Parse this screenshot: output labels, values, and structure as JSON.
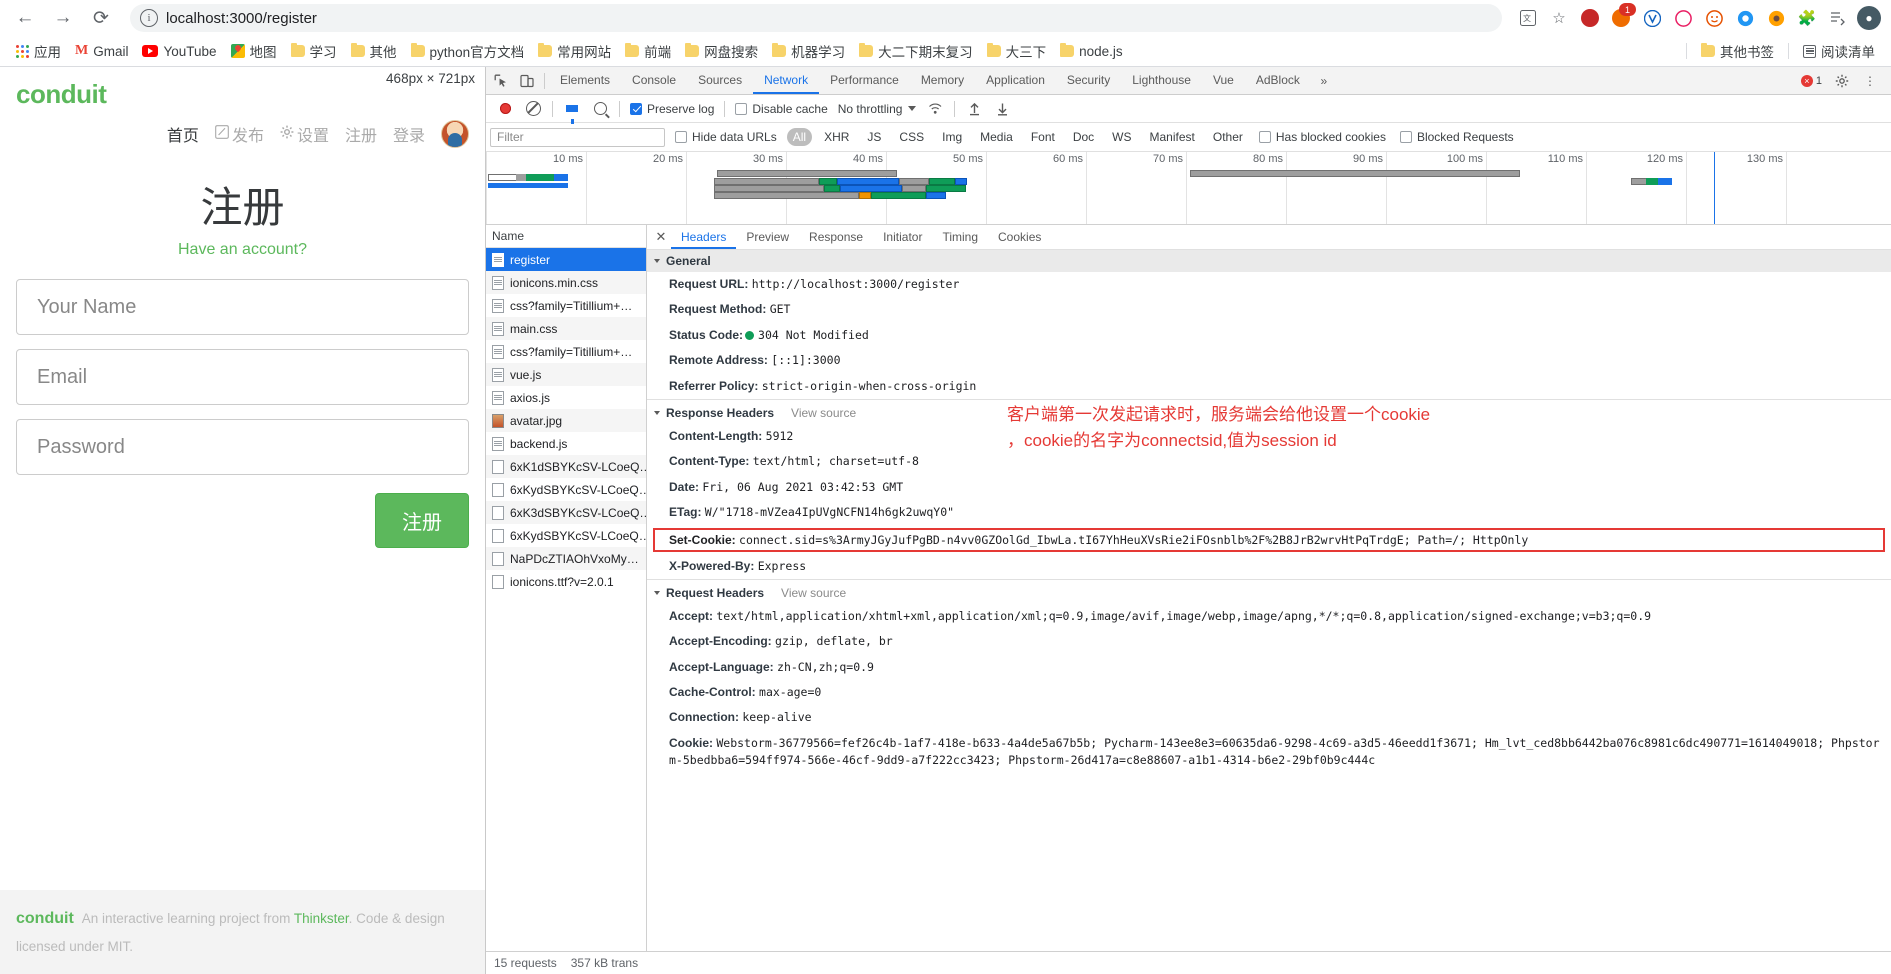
{
  "browser": {
    "back_icon": "back-arrow-icon",
    "forward_icon": "forward-arrow-icon",
    "reload_icon": "reload-icon",
    "url": "localhost:3000/register",
    "url_host": "localhost:3000",
    "url_path": "/register",
    "toolbar_icons": [
      "translate-icon",
      "bookmark-star-icon",
      "extension-shield-icon",
      "extension-badge-icon",
      "extension-v-icon",
      "extension-circle-icon",
      "extension-smiley-icon",
      "extension-blue-icon",
      "extension-orange-icon",
      "puzzle-extensions-icon",
      "menu-list-icon",
      "profile-avatar-icon"
    ],
    "notification_badge": "1",
    "bookmarks": [
      {
        "label": "应用",
        "icon": "apps-grid-icon"
      },
      {
        "label": "Gmail",
        "icon": "gmail-icon"
      },
      {
        "label": "YouTube",
        "icon": "youtube-icon"
      },
      {
        "label": "地图",
        "icon": "maps-icon"
      },
      {
        "label": "学习",
        "icon": "folder-icon"
      },
      {
        "label": "其他",
        "icon": "folder-icon"
      },
      {
        "label": "python官方文档",
        "icon": "folder-icon"
      },
      {
        "label": "常用网站",
        "icon": "folder-icon"
      },
      {
        "label": "前端",
        "icon": "folder-icon"
      },
      {
        "label": "网盘搜索",
        "icon": "folder-icon"
      },
      {
        "label": "机器学习",
        "icon": "folder-icon"
      },
      {
        "label": "大二下期末复习",
        "icon": "folder-icon"
      },
      {
        "label": "大三下",
        "icon": "folder-icon"
      },
      {
        "label": "node.js",
        "icon": "folder-icon"
      }
    ],
    "bookmarks_right": [
      {
        "label": "其他书签",
        "icon": "folder-icon"
      },
      {
        "label": "阅读清单",
        "icon": "reading-list-icon"
      }
    ]
  },
  "page": {
    "dimensions_badge": "468px × 721px",
    "brand": "conduit",
    "nav": [
      {
        "label": "首页",
        "icon": "",
        "active": true
      },
      {
        "label": "发布",
        "icon": "compose-icon",
        "active": false
      },
      {
        "label": "设置",
        "icon": "gear-icon",
        "active": false
      },
      {
        "label": "注册",
        "icon": "",
        "active": false
      },
      {
        "label": "登录",
        "icon": "",
        "active": false
      }
    ],
    "title": "注册",
    "subtitle": "Have an account?",
    "fields": [
      {
        "name": "username",
        "placeholder": "Your Name",
        "value": ""
      },
      {
        "name": "email",
        "placeholder": "Email",
        "value": ""
      },
      {
        "name": "password",
        "placeholder": "Password",
        "value": ""
      }
    ],
    "submit_label": "注册",
    "footer_brand": "conduit",
    "footer_text_1": "An interactive learning project from ",
    "footer_link": "Thinkster",
    "footer_text_2": ". Code & design licensed under MIT.",
    "accent_color": "#5cb85c"
  },
  "devtools": {
    "inspect_icon": "inspect-element-icon",
    "device_icon": "device-toolbar-icon",
    "panels": [
      "Elements",
      "Console",
      "Sources",
      "Network",
      "Performance",
      "Memory",
      "Application",
      "Security",
      "Lighthouse",
      "Vue",
      "AdBlock"
    ],
    "active_panel": "Network",
    "more_panels_icon": "chevron-double-right-icon",
    "error_count": "1",
    "settings_icon": "gear-icon",
    "kebab_icon": "more-vertical-icon",
    "network_toolbar": {
      "record_icon": "record-stop-icon",
      "clear_icon": "clear-icon",
      "filter_icon": "filter-funnel-icon",
      "search_icon": "search-icon",
      "preserve_log_label": "Preserve log",
      "preserve_log_checked": true,
      "disable_cache_label": "Disable cache",
      "disable_cache_checked": false,
      "throttling_label": "No throttling",
      "wifi_icon": "network-conditions-icon",
      "import_icon": "import-har-icon",
      "export_icon": "export-har-icon"
    },
    "filter_row": {
      "filter_placeholder": "Filter",
      "hide_data_urls_label": "Hide data URLs",
      "hide_data_urls_checked": false,
      "types": [
        "All",
        "XHR",
        "JS",
        "CSS",
        "Img",
        "Media",
        "Font",
        "Doc",
        "WS",
        "Manifest",
        "Other"
      ],
      "active_type": "All",
      "has_blocked_cookies_label": "Has blocked cookies",
      "has_blocked_cookies_checked": false,
      "blocked_requests_label": "Blocked Requests",
      "blocked_requests_checked": false
    },
    "overview": {
      "ticks": [
        "10 ms",
        "20 ms",
        "30 ms",
        "40 ms",
        "50 ms",
        "60 ms",
        "70 ms",
        "80 ms",
        "90 ms",
        "100 ms",
        "110 ms",
        "120 ms",
        "130 ms"
      ]
    },
    "requests_header": "Name",
    "requests": [
      {
        "name": "register",
        "icon": "document-icon",
        "selected": true
      },
      {
        "name": "ionicons.min.css",
        "icon": "document-icon",
        "selected": false
      },
      {
        "name": "css?family=Titillium+…",
        "icon": "document-icon",
        "selected": false
      },
      {
        "name": "main.css",
        "icon": "document-icon",
        "selected": false
      },
      {
        "name": "css?family=Titillium+…",
        "icon": "document-icon",
        "selected": false
      },
      {
        "name": "vue.js",
        "icon": "document-icon",
        "selected": false
      },
      {
        "name": "axios.js",
        "icon": "document-icon",
        "selected": false
      },
      {
        "name": "avatar.jpg",
        "icon": "image-icon",
        "selected": false
      },
      {
        "name": "backend.js",
        "icon": "document-icon",
        "selected": false
      },
      {
        "name": "6xK1dSBYKcSV-LCoeQ…",
        "icon": "font-icon",
        "selected": false
      },
      {
        "name": "6xKydSBYKcSV-LCoeQ…",
        "icon": "font-icon",
        "selected": false
      },
      {
        "name": "6xK3dSBYKcSV-LCoeQ…",
        "icon": "font-icon",
        "selected": false
      },
      {
        "name": "6xKydSBYKcSV-LCoeQ…",
        "icon": "font-icon",
        "selected": false
      },
      {
        "name": "NaPDcZTIAOhVxoMy…",
        "icon": "font-icon",
        "selected": false
      },
      {
        "name": "ionicons.ttf?v=2.0.1",
        "icon": "font-icon",
        "selected": false
      }
    ],
    "detail_tabs": [
      "Headers",
      "Preview",
      "Response",
      "Initiator",
      "Timing",
      "Cookies"
    ],
    "active_detail_tab": "Headers",
    "close_icon": "close-icon",
    "general": {
      "section_title": "General",
      "rows": [
        {
          "key": "Request URL:",
          "value": "http://localhost:3000/register"
        },
        {
          "key": "Request Method:",
          "value": "GET"
        },
        {
          "key": "Status Code:",
          "value": "304 Not Modified",
          "status": "ok"
        },
        {
          "key": "Remote Address:",
          "value": "[::1]:3000"
        },
        {
          "key": "Referrer Policy:",
          "value": "strict-origin-when-cross-origin"
        }
      ]
    },
    "response_headers": {
      "section_title": "Response Headers",
      "view_source": "View source",
      "rows": [
        {
          "key": "Content-Length:",
          "value": "5912"
        },
        {
          "key": "Content-Type:",
          "value": "text/html; charset=utf-8"
        },
        {
          "key": "Date:",
          "value": "Fri, 06 Aug 2021 03:42:53 GMT"
        },
        {
          "key": "ETag:",
          "value": "W/\"1718-mVZea4IpUVgNCFN14h6gk2uwqY0\""
        }
      ],
      "set_cookie_key": "Set-Cookie:",
      "set_cookie_value": "connect.sid=s%3ArmyJGyJufPgBD-n4vv0GZOolGd_IbwLa.tI67YhHeuXVsRie2iFOsnblb%2F%2B8JrB2wrvHtPqTrdgE; Path=/; HttpOnly",
      "rows_after": [
        {
          "key": "X-Powered-By:",
          "value": "Express"
        }
      ]
    },
    "request_headers": {
      "section_title": "Request Headers",
      "view_source": "View source",
      "rows": [
        {
          "key": "Accept:",
          "value": "text/html,application/xhtml+xml,application/xml;q=0.9,image/avif,image/webp,image/apng,*/*;q=0.8,application/signed-exchange;v=b3;q=0.9"
        },
        {
          "key": "Accept-Encoding:",
          "value": "gzip, deflate, br"
        },
        {
          "key": "Accept-Language:",
          "value": "zh-CN,zh;q=0.9"
        },
        {
          "key": "Cache-Control:",
          "value": "max-age=0"
        },
        {
          "key": "Connection:",
          "value": "keep-alive"
        },
        {
          "key": "Cookie:",
          "value": "Webstorm-36779566=fef26c4b-1af7-418e-b633-4a4de5a67b5b; Pycharm-143ee8e3=60635da6-9298-4c69-a3d5-46eedd1f3671; Hm_lvt_ced8bb6442ba076c8981c6dc490771=1614049018; Phpstorm-5bedbba6=594ff974-566e-46cf-9dd9-a7f222cc3423; Phpstorm-26d417a=c8e88607-a1b1-4314-b6e2-29bf0b9c444c"
        }
      ]
    },
    "annotation": {
      "line1": "客户端第一次发起请求时，服务端会给他设置一个cookie",
      "line2": "，cookie的名字为connectsid,值为session id",
      "color": "#e53935"
    },
    "status_bar": {
      "requests": "15 requests",
      "transferred": "357 kB trans"
    }
  }
}
